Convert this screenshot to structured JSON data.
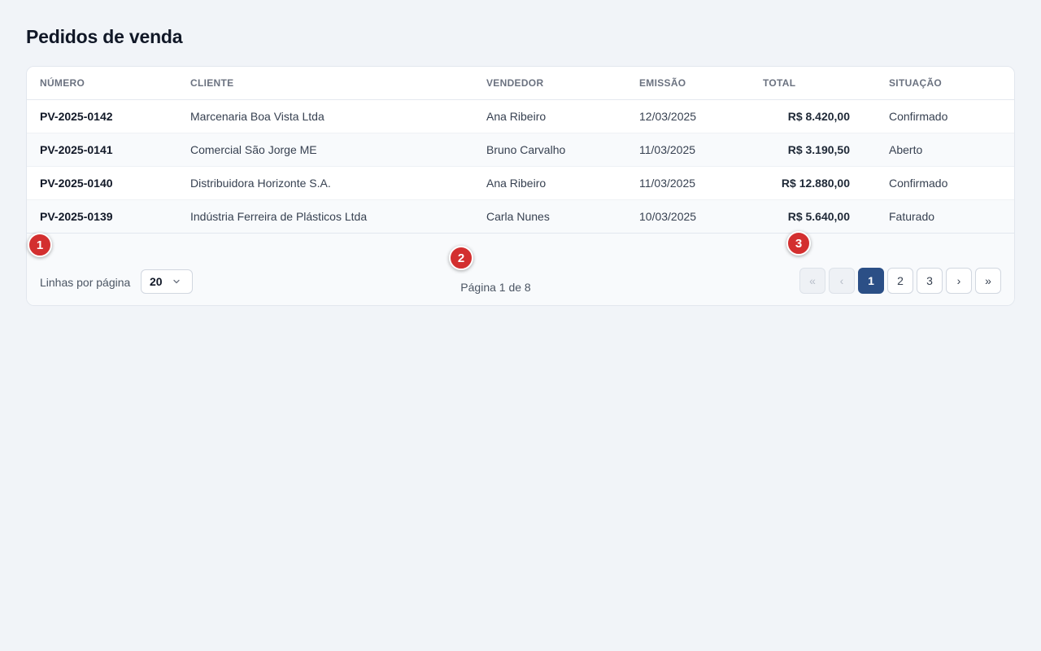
{
  "page": {
    "title": "Pedidos de venda"
  },
  "table": {
    "headers": [
      "NÚMERO",
      "CLIENTE",
      "VENDEDOR",
      "EMISSÃO",
      "TOTAL",
      "SITUAÇÃO"
    ],
    "rows": [
      {
        "numero": "PV-2025-0142",
        "cliente": "Marcenaria Boa Vista Ltda",
        "vendedor": "Ana Ribeiro",
        "emissao": "12/03/2025",
        "total": "R$ 8.420,00",
        "situacao": "Confirmado"
      },
      {
        "numero": "PV-2025-0141",
        "cliente": "Comercial São Jorge ME",
        "vendedor": "Bruno Carvalho",
        "emissao": "11/03/2025",
        "total": "R$ 3.190,50",
        "situacao": "Aberto"
      },
      {
        "numero": "PV-2025-0140",
        "cliente": "Distribuidora Horizonte S.A.",
        "vendedor": "Ana Ribeiro",
        "emissao": "11/03/2025",
        "total": "R$ 12.880,00",
        "situacao": "Confirmado"
      },
      {
        "numero": "PV-2025-0139",
        "cliente": "Indústria Ferreira de Plásticos Ltda",
        "vendedor": "Carla Nunes",
        "emissao": "10/03/2025",
        "total": "R$ 5.640,00",
        "situacao": "Faturado"
      }
    ]
  },
  "footer": {
    "rows_label": "Linhas por página",
    "rows_value": "20",
    "page_info": "Página 1 de 8",
    "pager": {
      "first": "«",
      "prev": "‹",
      "pages": [
        "1",
        "2",
        "3"
      ],
      "next": "›",
      "last": "»"
    }
  },
  "markers": [
    "1",
    "2",
    "3"
  ],
  "colors": {
    "accent": "#2b4f86",
    "marker": "#d32f2f",
    "background": "#f1f4f8"
  }
}
